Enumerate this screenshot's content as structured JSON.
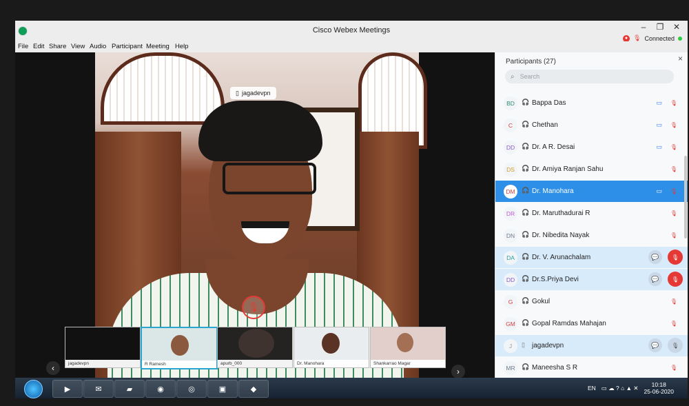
{
  "window": {
    "title": "Cisco Webex Meetings",
    "controls": [
      "–",
      "❐",
      "✕"
    ],
    "status": "Connected"
  },
  "menu": [
    "File",
    "Edit",
    "Share",
    "View",
    "Audio",
    "Participant",
    "Meeting",
    "Help"
  ],
  "video": {
    "speaker_name": "jagadevpn",
    "mute_icon": "mic-muted-icon",
    "thumbnails": [
      "jagadevpn",
      "R Ramesh",
      "apurb_000",
      "Dr. Manohara",
      "Shankarrao Magar"
    ]
  },
  "participants": {
    "title": "Participants (27)",
    "search_placeholder": "Search",
    "items": [
      {
        "initials": "BD",
        "name": "Bappa Das",
        "device": "🎧",
        "video": true,
        "mic": "muted"
      },
      {
        "initials": "C",
        "name": "Chethan",
        "device": "🎧",
        "video": true,
        "mic": "muted"
      },
      {
        "initials": "DD",
        "name": "Dr. A R. Desai",
        "device": "🎧",
        "video": true,
        "mic": "muted"
      },
      {
        "initials": "DS",
        "name": "Dr. Amiya Ranjan Sahu",
        "device": "🎧",
        "video": false,
        "mic": "muted"
      },
      {
        "initials": "DM",
        "name": "Dr. Manohara",
        "device": "🎧",
        "video": true,
        "mic": "muted",
        "selected": true
      },
      {
        "initials": "DR",
        "name": "Dr. Maruthadurai R",
        "device": "🎧",
        "video": false,
        "mic": "muted"
      },
      {
        "initials": "DN",
        "name": "Dr. Nibedita Nayak",
        "device": "🎧",
        "video": false,
        "mic": "muted"
      },
      {
        "initials": "DA",
        "name": "Dr. V. Arunachalam",
        "device": "🎧",
        "video": false,
        "mic": "muted-big",
        "highlight": true,
        "chat": true
      },
      {
        "initials": "DD",
        "name": "Dr.S.Priya Devi",
        "device": "🎧",
        "video": false,
        "mic": "muted-big",
        "highlight": true,
        "chat": true
      },
      {
        "initials": "G",
        "name": "Gokul",
        "device": "🎧",
        "video": false,
        "mic": "muted"
      },
      {
        "initials": "GM",
        "name": "Gopal Ramdas Mahajan",
        "device": "🎧",
        "video": false,
        "mic": "muted"
      },
      {
        "initials": "J",
        "name": "jagadevpn",
        "device": "▯",
        "video": false,
        "mic": "muted-grey",
        "highlight": true,
        "chat": true
      },
      {
        "initials": "MR",
        "name": "Maneesha S R",
        "device": "🎧",
        "video": false,
        "mic": "muted"
      }
    ]
  },
  "taskbar": {
    "language": "EN",
    "time": "10:18",
    "date": "25-06-2020"
  }
}
